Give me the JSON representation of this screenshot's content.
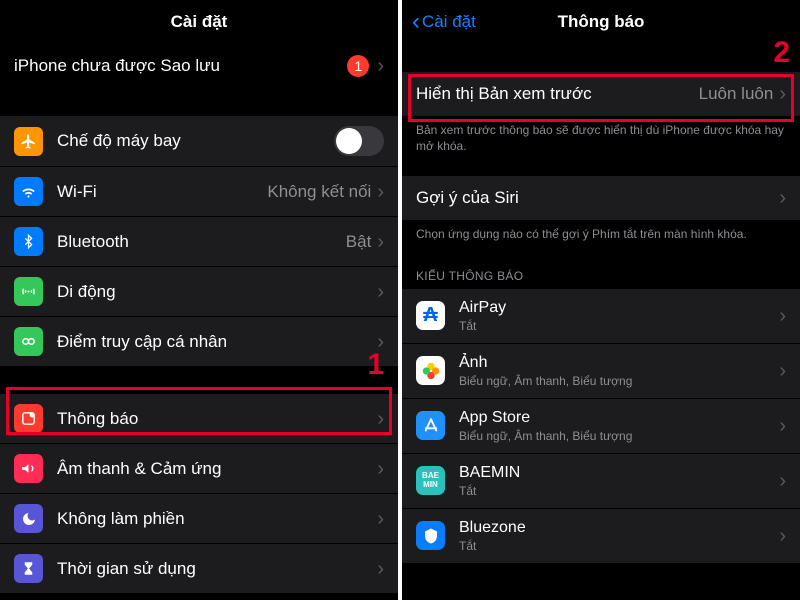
{
  "left": {
    "title": "Cài đặt",
    "backup": {
      "label": "iPhone chưa được Sao lưu",
      "badge": "1"
    },
    "items": [
      {
        "label": "Chế độ máy bay"
      },
      {
        "label": "Wi-Fi",
        "detail": "Không kết nối"
      },
      {
        "label": "Bluetooth",
        "detail": "Bật"
      },
      {
        "label": "Di động"
      },
      {
        "label": "Điểm truy cập cá nhân"
      }
    ],
    "group2": [
      {
        "label": "Thông báo"
      },
      {
        "label": "Âm thanh & Cảm ứng"
      },
      {
        "label": "Không làm phiền"
      },
      {
        "label": "Thời gian sử dụng"
      }
    ],
    "callout_num": "1"
  },
  "right": {
    "back": "Cài đặt",
    "title": "Thông báo",
    "preview": {
      "label": "Hiển thị Bản xem trước",
      "detail": "Luôn luôn"
    },
    "preview_footer": "Bản xem trước thông báo sẽ được hiển thị dù iPhone được khóa hay mở khóa.",
    "siri": {
      "label": "Gợi ý của Siri"
    },
    "siri_footer": "Chọn ứng dụng nào có thể gợi ý Phím tắt trên màn hình khóa.",
    "section_header": "KIỂU THÔNG BÁO",
    "apps": [
      {
        "name": "AirPay",
        "sub": "Tắt"
      },
      {
        "name": "Ảnh",
        "sub": "Biểu ngữ, Âm thanh, Biểu tượng"
      },
      {
        "name": "App Store",
        "sub": "Biểu ngữ, Âm thanh, Biểu tượng"
      },
      {
        "name": "BAEMIN",
        "sub": "Tắt"
      },
      {
        "name": "Bluezone",
        "sub": "Tắt"
      }
    ],
    "callout_num": "2"
  }
}
